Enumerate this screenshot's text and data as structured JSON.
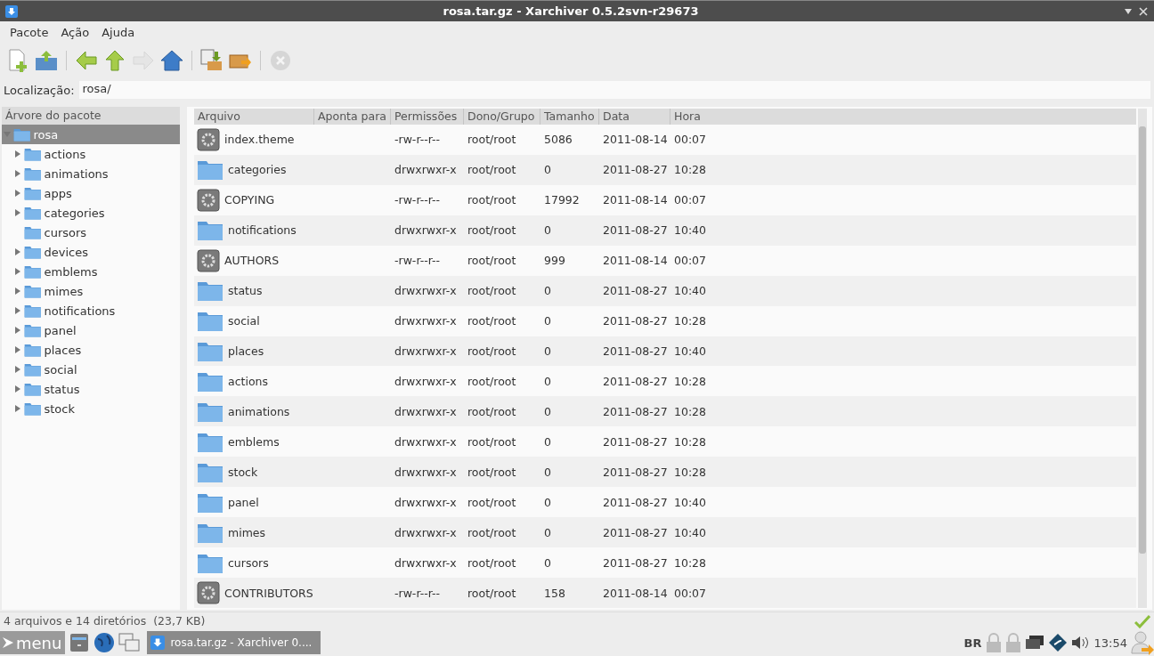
{
  "window": {
    "title": "rosa.tar.gz - Xarchiver 0.5.2svn-r29673"
  },
  "menu": [
    "Pacote",
    "Ação",
    "Ajuda"
  ],
  "toolbar": [
    {
      "kind": "new"
    },
    {
      "kind": "open"
    },
    {
      "kind": "sep"
    },
    {
      "kind": "back",
      "disabled": false
    },
    {
      "kind": "up",
      "disabled": false
    },
    {
      "kind": "forward",
      "disabled": true
    },
    {
      "kind": "home",
      "disabled": false
    },
    {
      "kind": "sep"
    },
    {
      "kind": "extract",
      "disabled": false
    },
    {
      "kind": "convert",
      "disabled": false
    },
    {
      "kind": "sep"
    },
    {
      "kind": "stop",
      "disabled": true
    }
  ],
  "location": {
    "label": "Localização:",
    "value": "rosa/"
  },
  "tree": {
    "title": "Árvore do pacote",
    "items": [
      {
        "label": "rosa",
        "expanded": true,
        "selected": true,
        "children": [
          {
            "label": "actions",
            "expandable": true,
            "selected": false
          },
          {
            "label": "animations",
            "expandable": true,
            "selected": false
          },
          {
            "label": "apps",
            "expandable": true,
            "selected": false
          },
          {
            "label": "categories",
            "expandable": true,
            "selected": false
          },
          {
            "label": "cursors",
            "expandable": false,
            "selected": false
          },
          {
            "label": "devices",
            "expandable": true,
            "selected": false
          },
          {
            "label": "emblems",
            "expandable": true,
            "selected": false
          },
          {
            "label": "mimes",
            "expandable": true,
            "selected": false
          },
          {
            "label": "notifications",
            "expandable": true,
            "selected": false
          },
          {
            "label": "panel",
            "expandable": true,
            "selected": false
          },
          {
            "label": "places",
            "expandable": true,
            "selected": false
          },
          {
            "label": "social",
            "expandable": true,
            "selected": false
          },
          {
            "label": "status",
            "expandable": true,
            "selected": false
          },
          {
            "label": "stock",
            "expandable": true,
            "selected": false
          }
        ]
      }
    ]
  },
  "table": {
    "columns": [
      "Arquivo",
      "Aponta para",
      "Permissões",
      "Dono/Grupo",
      "Tamanho",
      "Data",
      "Hora"
    ],
    "rows": [
      {
        "kind": "file",
        "name": "index.theme",
        "perm": "-rw-r--r--",
        "owner": "root/root",
        "size": "5086",
        "date": "2011-08-14",
        "time": "00:07"
      },
      {
        "kind": "folder",
        "name": "categories",
        "perm": "drwxrwxr-x",
        "owner": "root/root",
        "size": "0",
        "date": "2011-08-27",
        "time": "10:28"
      },
      {
        "kind": "file",
        "name": "COPYING",
        "perm": "-rw-r--r--",
        "owner": "root/root",
        "size": "17992",
        "date": "2011-08-14",
        "time": "00:07"
      },
      {
        "kind": "folder",
        "name": "notifications",
        "perm": "drwxrwxr-x",
        "owner": "root/root",
        "size": "0",
        "date": "2011-08-27",
        "time": "10:40"
      },
      {
        "kind": "file",
        "name": "AUTHORS",
        "perm": "-rw-r--r--",
        "owner": "root/root",
        "size": "999",
        "date": "2011-08-14",
        "time": "00:07"
      },
      {
        "kind": "folder",
        "name": "status",
        "perm": "drwxrwxr-x",
        "owner": "root/root",
        "size": "0",
        "date": "2011-08-27",
        "time": "10:40"
      },
      {
        "kind": "folder",
        "name": "social",
        "perm": "drwxrwxr-x",
        "owner": "root/root",
        "size": "0",
        "date": "2011-08-27",
        "time": "10:28"
      },
      {
        "kind": "folder",
        "name": "places",
        "perm": "drwxrwxr-x",
        "owner": "root/root",
        "size": "0",
        "date": "2011-08-27",
        "time": "10:40"
      },
      {
        "kind": "folder",
        "name": "actions",
        "perm": "drwxrwxr-x",
        "owner": "root/root",
        "size": "0",
        "date": "2011-08-27",
        "time": "10:28"
      },
      {
        "kind": "folder",
        "name": "animations",
        "perm": "drwxrwxr-x",
        "owner": "root/root",
        "size": "0",
        "date": "2011-08-27",
        "time": "10:28"
      },
      {
        "kind": "folder",
        "name": "emblems",
        "perm": "drwxrwxr-x",
        "owner": "root/root",
        "size": "0",
        "date": "2011-08-27",
        "time": "10:28"
      },
      {
        "kind": "folder",
        "name": "stock",
        "perm": "drwxrwxr-x",
        "owner": "root/root",
        "size": "0",
        "date": "2011-08-27",
        "time": "10:28"
      },
      {
        "kind": "folder",
        "name": "panel",
        "perm": "drwxrwxr-x",
        "owner": "root/root",
        "size": "0",
        "date": "2011-08-27",
        "time": "10:40"
      },
      {
        "kind": "folder",
        "name": "mimes",
        "perm": "drwxrwxr-x",
        "owner": "root/root",
        "size": "0",
        "date": "2011-08-27",
        "time": "10:40"
      },
      {
        "kind": "folder",
        "name": "cursors",
        "perm": "drwxrwxr-x",
        "owner": "root/root",
        "size": "0",
        "date": "2011-08-27",
        "time": "10:28"
      },
      {
        "kind": "file",
        "name": "CONTRIBUTORS",
        "perm": "-rw-r--r--",
        "owner": "root/root",
        "size": "158",
        "date": "2011-08-14",
        "time": "00:07"
      }
    ]
  },
  "status_bar": "4 arquivos e 14 diretórios  (23,7 KB)",
  "taskbar": {
    "menu": "menu",
    "task": "rosa.tar.gz - Xarchiver 0....",
    "layout": "BR",
    "clock": "13:54"
  }
}
